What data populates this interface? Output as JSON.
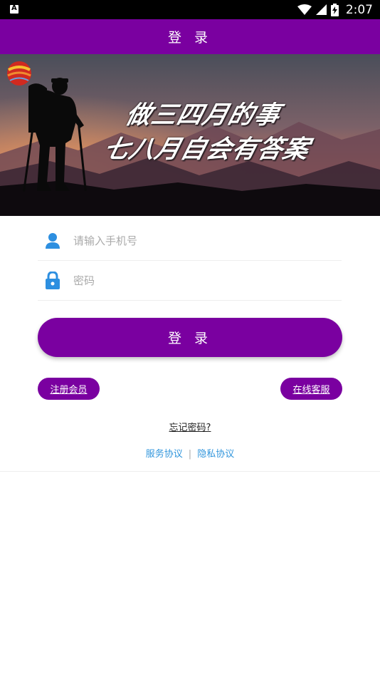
{
  "status_bar": {
    "time": "2:07"
  },
  "header": {
    "title": "登 录"
  },
  "banner": {
    "line1": "做三四月的事",
    "line2": "七八月自会有答案"
  },
  "form": {
    "phone_placeholder": "请输入手机号",
    "password_placeholder": "密码"
  },
  "login_button": "登 录",
  "links": {
    "register": "注册会员",
    "customer_service": "在线客服",
    "forgot_password": "忘记密码?",
    "service_agreement": "服务协议",
    "separator": "|",
    "privacy_agreement": "隐私协议"
  },
  "colors": {
    "primary": "#7a00a0",
    "link": "#3296dc",
    "icon": "#2d8fe0"
  }
}
